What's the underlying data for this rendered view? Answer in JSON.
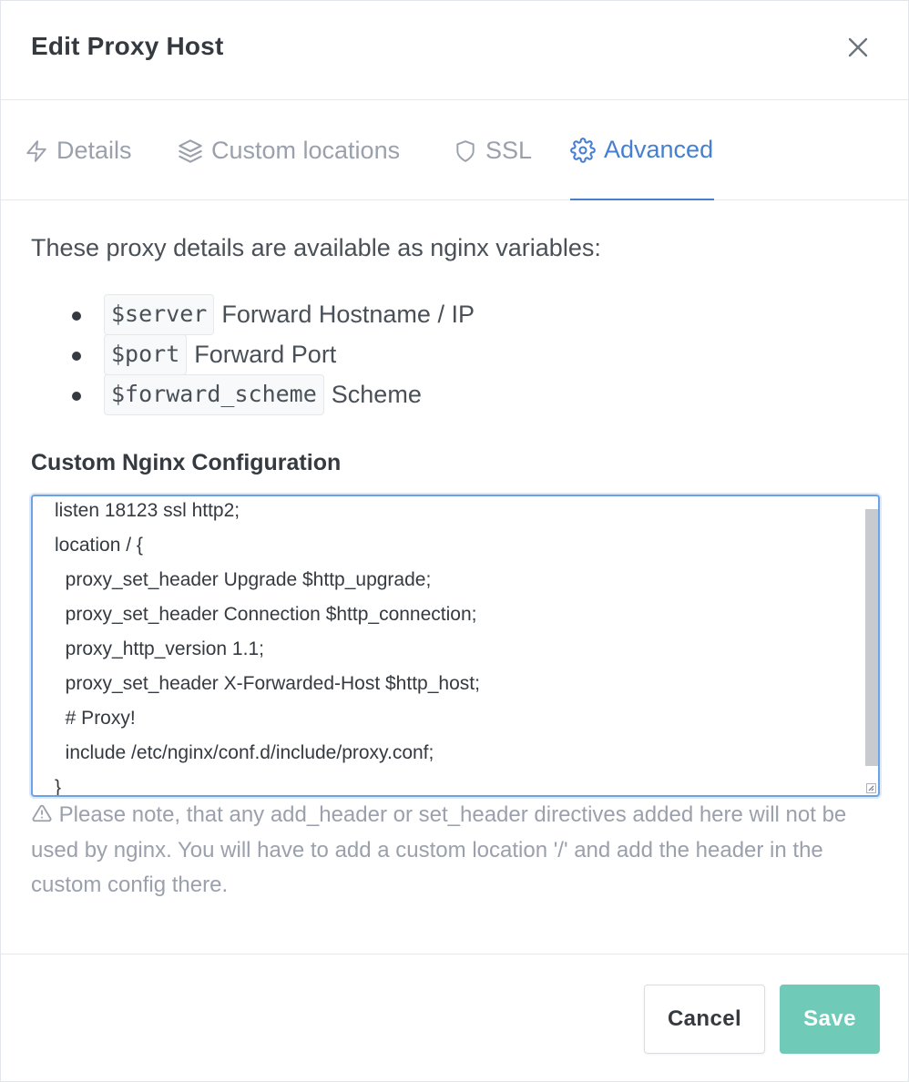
{
  "modal": {
    "title": "Edit Proxy Host",
    "close_icon": "close-icon"
  },
  "tabs": [
    {
      "label": "Details",
      "icon": "bolt-icon",
      "active": false
    },
    {
      "label": "Custom locations",
      "icon": "layers-icon",
      "active": false
    },
    {
      "label": "SSL",
      "icon": "shield-icon",
      "active": false
    },
    {
      "label": "Advanced",
      "icon": "gear-icon",
      "active": true
    }
  ],
  "advanced": {
    "intro": "These proxy details are available as nginx variables:",
    "variables": [
      {
        "code": "$server",
        "desc": "Forward Hostname / IP"
      },
      {
        "code": "$port",
        "desc": "Forward Port"
      },
      {
        "code": "$forward_scheme",
        "desc": "Scheme"
      }
    ],
    "config_label": "Custom Nginx Configuration",
    "config_lines": [
      "listen 18123 ssl http2;",
      "location / {",
      "  proxy_set_header Upgrade $http_upgrade;",
      "  proxy_set_header Connection $http_connection;",
      "  proxy_http_version 1.1;",
      "  proxy_set_header X-Forwarded-Host $http_host;",
      "  # Proxy!",
      "  include /etc/nginx/conf.d/include/proxy.conf;",
      "}"
    ],
    "note": "Please note, that any add_header or set_header directives added here will not be used by nginx. You will have to add a custom location '/' and add the header in the custom config there."
  },
  "footer": {
    "cancel_label": "Cancel",
    "save_label": "Save"
  },
  "colors": {
    "accent": "#467fcf",
    "save": "#6fcab8",
    "muted": "#9aa0ac"
  }
}
